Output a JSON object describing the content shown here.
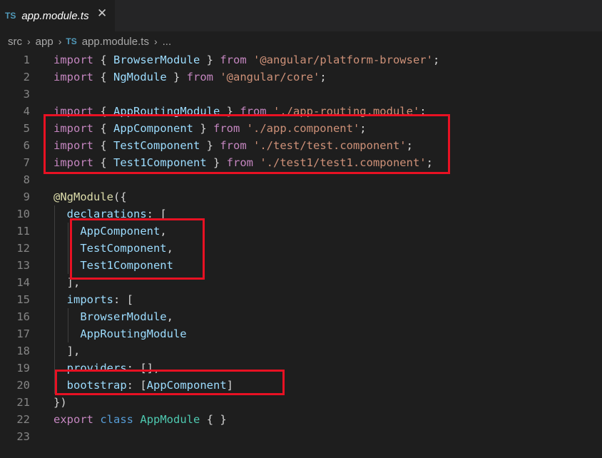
{
  "tab": {
    "lang_badge": "TS",
    "title": "app.module.ts",
    "close": "✕"
  },
  "breadcrumb": {
    "items": [
      "src",
      "app"
    ],
    "file_badge": "TS",
    "file": "app.module.ts",
    "more": "...",
    "sep": "›"
  },
  "editor": {
    "line_numbers": [
      "1",
      "2",
      "3",
      "4",
      "5",
      "6",
      "7",
      "8",
      "9",
      "10",
      "11",
      "12",
      "13",
      "14",
      "15",
      "16",
      "17",
      "18",
      "19",
      "20",
      "21",
      "22",
      "23"
    ],
    "lines": [
      [
        [
          "kw",
          "import"
        ],
        [
          "punc",
          " { "
        ],
        [
          "id",
          "BrowserModule"
        ],
        [
          "punc",
          " } "
        ],
        [
          "kw",
          "from"
        ],
        [
          "punc",
          " "
        ],
        [
          "str",
          "'@angular/platform-browser'"
        ],
        [
          "punc",
          ";"
        ]
      ],
      [
        [
          "kw",
          "import"
        ],
        [
          "punc",
          " { "
        ],
        [
          "id",
          "NgModule"
        ],
        [
          "punc",
          " } "
        ],
        [
          "kw",
          "from"
        ],
        [
          "punc",
          " "
        ],
        [
          "str",
          "'@angular/core'"
        ],
        [
          "punc",
          ";"
        ]
      ],
      [],
      [
        [
          "kw",
          "import"
        ],
        [
          "punc",
          " { "
        ],
        [
          "id",
          "AppRoutingModule"
        ],
        [
          "punc",
          " } "
        ],
        [
          "kw",
          "from"
        ],
        [
          "punc",
          " "
        ],
        [
          "str",
          "'./app-routing.module'"
        ],
        [
          "punc",
          ";"
        ]
      ],
      [
        [
          "kw",
          "import"
        ],
        [
          "punc",
          " { "
        ],
        [
          "id",
          "AppComponent"
        ],
        [
          "punc",
          " } "
        ],
        [
          "kw",
          "from"
        ],
        [
          "punc",
          " "
        ],
        [
          "str",
          "'./app.component'"
        ],
        [
          "punc",
          ";"
        ]
      ],
      [
        [
          "kw",
          "import"
        ],
        [
          "punc",
          " { "
        ],
        [
          "id",
          "TestComponent"
        ],
        [
          "punc",
          " } "
        ],
        [
          "kw",
          "from"
        ],
        [
          "punc",
          " "
        ],
        [
          "str",
          "'./test/test.component'"
        ],
        [
          "punc",
          ";"
        ]
      ],
      [
        [
          "kw",
          "import"
        ],
        [
          "punc",
          " { "
        ],
        [
          "id",
          "Test1Component"
        ],
        [
          "punc",
          " } "
        ],
        [
          "kw",
          "from"
        ],
        [
          "punc",
          " "
        ],
        [
          "str",
          "'./test1/test1.component'"
        ],
        [
          "punc",
          ";"
        ]
      ],
      [],
      [
        [
          "fn",
          "@NgModule"
        ],
        [
          "punc",
          "({"
        ]
      ],
      [
        [
          "punc",
          "  "
        ],
        [
          "id",
          "declarations"
        ],
        [
          "punc",
          ": ["
        ]
      ],
      [
        [
          "punc",
          "    "
        ],
        [
          "id",
          "AppComponent"
        ],
        [
          "punc",
          ","
        ]
      ],
      [
        [
          "punc",
          "    "
        ],
        [
          "id",
          "TestComponent"
        ],
        [
          "punc",
          ","
        ]
      ],
      [
        [
          "punc",
          "    "
        ],
        [
          "id",
          "Test1Component"
        ]
      ],
      [
        [
          "punc",
          "  ],"
        ]
      ],
      [
        [
          "punc",
          "  "
        ],
        [
          "id",
          "imports"
        ],
        [
          "punc",
          ": ["
        ]
      ],
      [
        [
          "punc",
          "    "
        ],
        [
          "id",
          "BrowserModule"
        ],
        [
          "punc",
          ","
        ]
      ],
      [
        [
          "punc",
          "    "
        ],
        [
          "id",
          "AppRoutingModule"
        ]
      ],
      [
        [
          "punc",
          "  ],"
        ]
      ],
      [
        [
          "punc",
          "  "
        ],
        [
          "id",
          "providers"
        ],
        [
          "punc",
          ": [],"
        ]
      ],
      [
        [
          "punc",
          "  "
        ],
        [
          "id",
          "bootstrap"
        ],
        [
          "punc",
          ": ["
        ],
        [
          "id",
          "AppComponent"
        ],
        [
          "punc",
          "]"
        ]
      ],
      [
        [
          "punc",
          "})"
        ]
      ],
      [
        [
          "kw",
          "export"
        ],
        [
          "punc",
          " "
        ],
        [
          "kw-blue",
          "class"
        ],
        [
          "punc",
          " "
        ],
        [
          "cls",
          "AppModule"
        ],
        [
          "punc",
          " { }"
        ]
      ],
      []
    ]
  }
}
